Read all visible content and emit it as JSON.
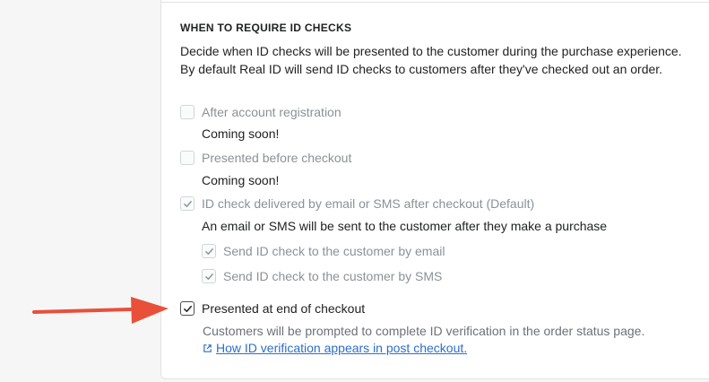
{
  "section": {
    "heading": "WHEN TO REQUIRE ID CHECKS",
    "description": "Decide when ID checks will be presented to the customer during the purchase experience. By default Real ID will send ID checks to customers after they've checked out an order."
  },
  "options": [
    {
      "label": "After account registration",
      "subtext": "Coming soon!",
      "checked": false,
      "disabled": true
    },
    {
      "label": "Presented before checkout",
      "subtext": "Coming soon!",
      "checked": false,
      "disabled": true
    },
    {
      "label": "ID check delivered by email or SMS after checkout (Default)",
      "subtext": "An email or SMS will be sent to the customer after they make a purchase",
      "checked": true,
      "disabled": true
    }
  ],
  "suboptions": [
    {
      "label": "Send ID check to the customer by email",
      "checked": true,
      "disabled": true
    },
    {
      "label": "Send ID check to the customer by SMS",
      "checked": true,
      "disabled": true
    }
  ],
  "end_of_checkout": {
    "label": "Presented at end of checkout",
    "checked": true,
    "help": "Customers will be prompted to complete ID verification in the order status page.",
    "link_text": "How ID verification appears in post checkout.",
    "link_icon": "external-link-icon"
  },
  "colors": {
    "arrow": "#e8503a",
    "link": "#2c6ecb"
  }
}
